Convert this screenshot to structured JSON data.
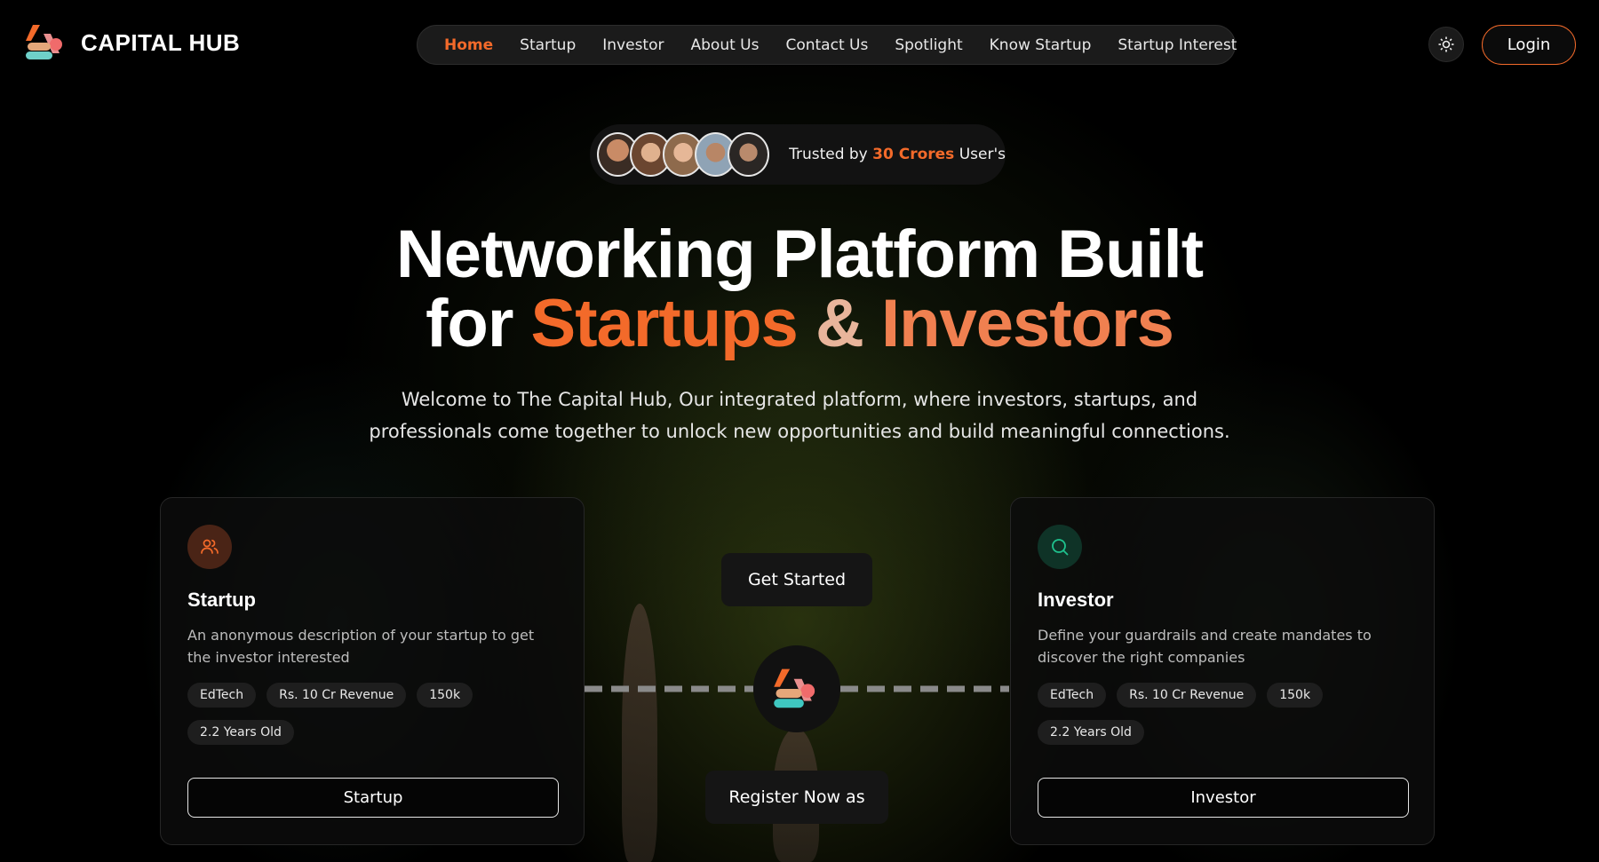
{
  "brand": {
    "name": "CAPITAL HUB"
  },
  "nav": {
    "items": [
      {
        "label": "Home",
        "active": true
      },
      {
        "label": "Startup"
      },
      {
        "label": "Investor"
      },
      {
        "label": "About Us"
      },
      {
        "label": "Contact Us"
      },
      {
        "label": "Spotlight"
      },
      {
        "label": "Know Startup"
      },
      {
        "label": "Startup Interest"
      }
    ],
    "theme_icon": "sun-icon",
    "login_label": "Login"
  },
  "trusted": {
    "prefix": "Trusted by ",
    "highlight": "30 Crores",
    "suffix": " User's"
  },
  "hero": {
    "title_line1": "Networking Platform Built",
    "title_for": "for ",
    "title_startups": "Startups",
    "title_amp": " & ",
    "title_investors": "Investors",
    "subtitle_line1": "Welcome to The Capital Hub, Our integrated platform, where investors, startups, and",
    "subtitle_line2": "professionals come together to unlock new opportunities and build meaningful connections."
  },
  "cards": {
    "startup": {
      "icon": "users-icon",
      "title": "Startup",
      "description": "An anonymous description of your startup to get the investor interested",
      "tags": [
        "EdTech",
        "Rs. 10 Cr Revenue",
        "150k",
        "2.2 Years Old"
      ],
      "button": "Startup"
    },
    "investor": {
      "icon": "search-icon",
      "title": "Investor",
      "description": "Define your guardrails and create mandates to discover the right companies",
      "tags": [
        "EdTech",
        "Rs. 10 Cr Revenue",
        "150k",
        "2.2 Years Old"
      ],
      "button": "Investor"
    }
  },
  "center": {
    "get_started": "Get Started",
    "register": "Register Now as"
  },
  "colors": {
    "accent": "#f36a2a",
    "investor_icon": "#1fc28e"
  }
}
